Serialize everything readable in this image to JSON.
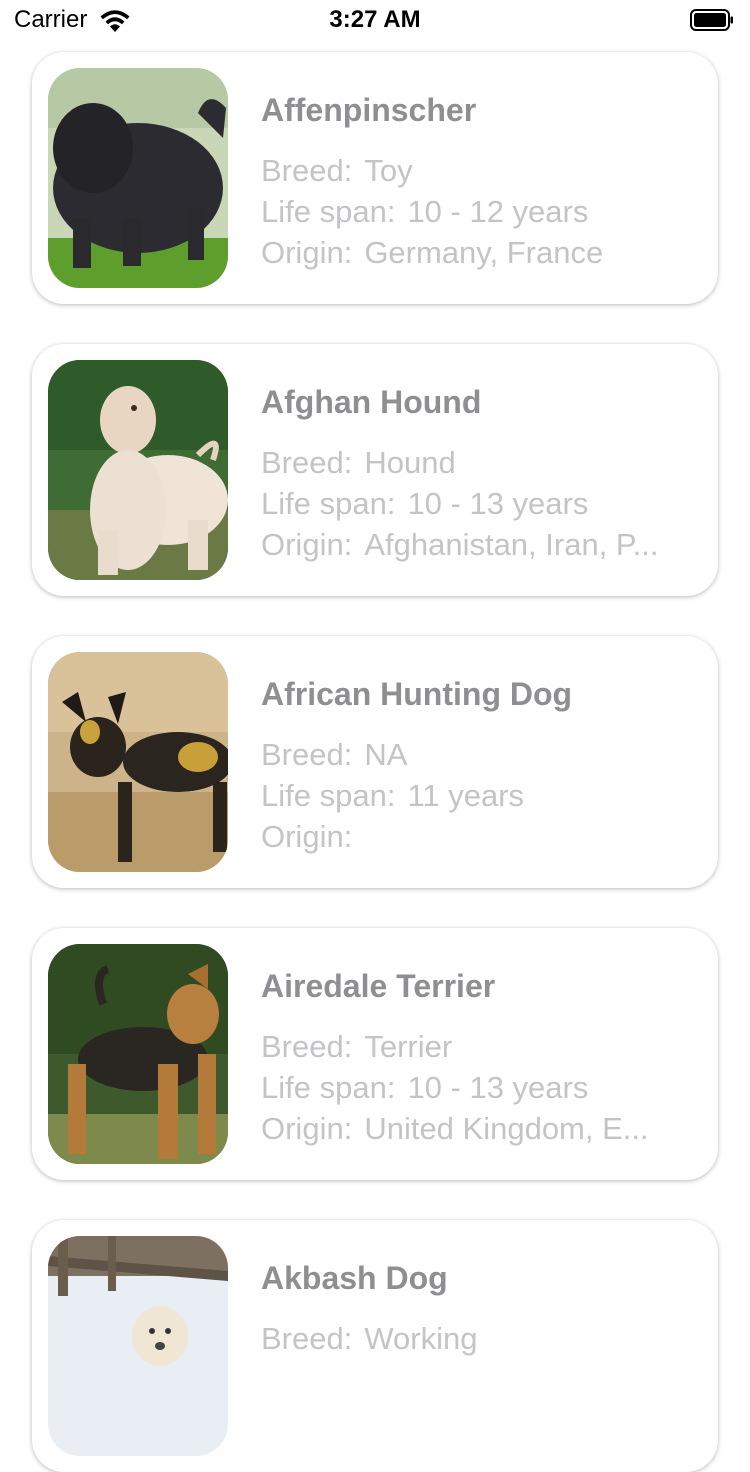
{
  "status_bar": {
    "carrier": "Carrier",
    "time": "3:27 AM",
    "icons": [
      "wifi-icon",
      "battery-icon"
    ]
  },
  "breeds": [
    {
      "name": "Affenpinscher",
      "breed_label": "Breed:",
      "breed": "Toy",
      "life_label": "Life span:",
      "life_span": "10 - 12 years",
      "origin_label": "Origin:",
      "origin": "Germany, France",
      "photo": "affenpinscher-photo"
    },
    {
      "name": "Afghan Hound",
      "breed_label": "Breed:",
      "breed": "Hound",
      "life_label": "Life span:",
      "life_span": "10 - 13 years",
      "origin_label": "Origin:",
      "origin": "Afghanistan, Iran, P...",
      "photo": "afghan-hound-photo"
    },
    {
      "name": "African Hunting Dog",
      "breed_label": "Breed:",
      "breed": "NA",
      "life_label": "Life span:",
      "life_span": "11 years",
      "origin_label": "Origin:",
      "origin": "",
      "photo": "african-hunting-dog-photo"
    },
    {
      "name": "Airedale Terrier",
      "breed_label": "Breed:",
      "breed": "Terrier",
      "life_label": "Life span:",
      "life_span": "10 - 13 years",
      "origin_label": "Origin:",
      "origin": "United Kingdom, E...",
      "photo": "airedale-terrier-photo"
    },
    {
      "name": "Akbash Dog",
      "breed_label": "Breed:",
      "breed": "Working",
      "life_label": "",
      "life_span": "",
      "origin_label": "",
      "origin": "",
      "photo": "akbash-dog-photo"
    }
  ],
  "colors": {
    "title_text": "#8e8e93",
    "detail_text": "#c4c4c7",
    "card_background": "#ffffff"
  }
}
